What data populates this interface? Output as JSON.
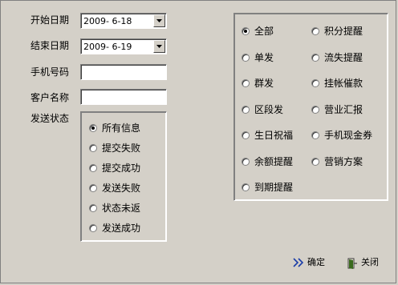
{
  "filters": {
    "start_date_label": "开始日期",
    "start_date_value": "2009- 6-18",
    "end_date_label": "结束日期",
    "end_date_value": "2009- 6-19",
    "phone_label": "手机号码",
    "phone_value": "",
    "customer_label": "客户名称",
    "customer_value": ""
  },
  "status": {
    "label": "发送状态",
    "selected": "所有信息",
    "options": [
      "所有信息",
      "提交失败",
      "提交成功",
      "发送失败",
      "状态未返",
      "发送成功"
    ]
  },
  "types": {
    "selected": "全部",
    "left": [
      "全部",
      "单发",
      "群发",
      "区段发",
      "生日祝福",
      "余额提醒",
      "到期提醒"
    ],
    "right": [
      "积分提醒",
      "流失提醒",
      "挂帐催款",
      "营业汇报",
      "手机现金券",
      "营销方案"
    ]
  },
  "actions": {
    "confirm_label": "确定",
    "close_label": "关闭"
  },
  "icons": {
    "confirm": "double-chevron-right-icon",
    "close": "exit-door-icon"
  },
  "colors": {
    "background": "#d4d0c8",
    "confirm_icon": "#1a3ca8",
    "close_icon": "#3a6a1e"
  }
}
